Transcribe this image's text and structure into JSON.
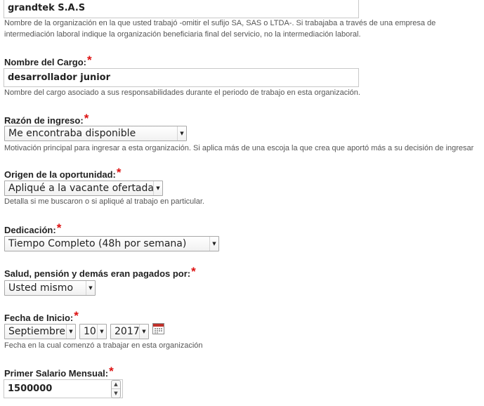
{
  "organization": {
    "value": "grandtek S.A.S",
    "help": "Nombre de la organización en la que usted trabajó -omitir el sufijo SA, SAS o LTDA-. Si trabajaba a través de una empresa de intermediación laboral indique la organización beneficiaria final del servicio, no la intermediación laboral."
  },
  "cargo": {
    "label": "Nombre del Cargo:",
    "value": "desarrollador junior",
    "help": "Nombre del cargo asociado a sus responsabilidades durante el periodo de trabajo en esta organización."
  },
  "razon": {
    "label": "Razón de ingreso:",
    "value": "Me encontraba disponible",
    "help": "Motivación principal para ingresar a esta organización. Si aplica más de una escoja la que crea que aportó más a su decisión de ingresar"
  },
  "origen": {
    "label": "Origen de la oportunidad:",
    "value": "Apliqué a la vacante ofertada",
    "help": "Detalla si me buscaron o si apliqué al trabajo en particular."
  },
  "dedicacion": {
    "label": "Dedicación:",
    "value": "Tiempo Completo (48h por semana)"
  },
  "salud": {
    "label": "Salud, pensión y demás eran pagados por:",
    "value": "Usted mismo"
  },
  "fecha": {
    "label": "Fecha de Inicio:",
    "month": "Septiembre",
    "day": "10",
    "year": "2017",
    "help": "Fecha en la cual comenzó a trabajar en esta organización"
  },
  "salario": {
    "label": "Primer Salario Mensual:",
    "value": "1500000"
  },
  "required_mark": "*",
  "icons": {
    "dropdown": "chevron-down-icon",
    "calendar": "calendar-icon",
    "spin_up": "spin-up-icon",
    "spin_down": "spin-down-icon"
  },
  "colors": {
    "required": "#dd1111",
    "help_text": "#555555"
  }
}
